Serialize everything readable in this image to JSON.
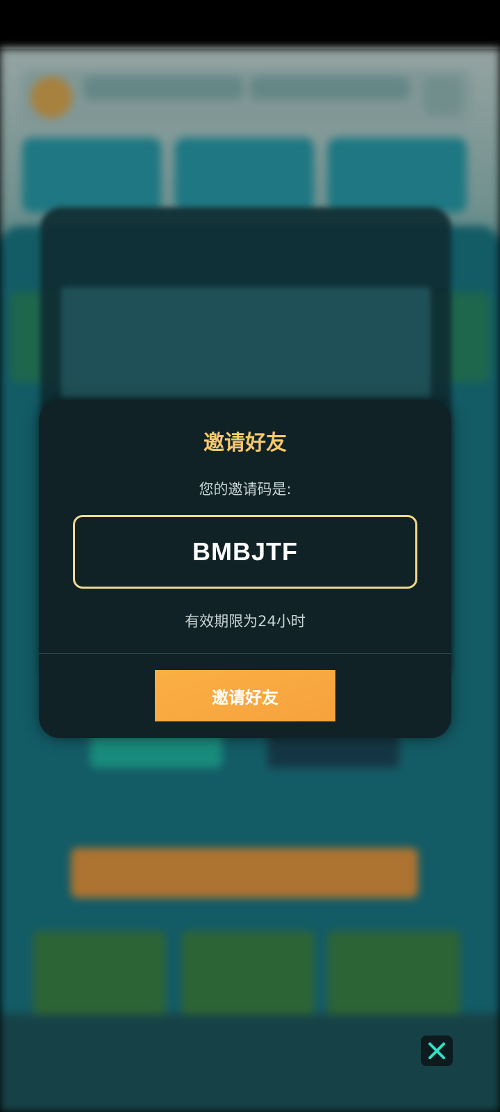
{
  "modal": {
    "title": "邀请好友",
    "subtitle": "您的邀请码是:",
    "invite_code": "BMBJTF",
    "expiry_note": "有效期限为24小时",
    "button_label": "邀请好友"
  },
  "colors": {
    "modal_background": "#102226",
    "title": "#f8c86b",
    "code_border": "#f1d88c",
    "button": "#f6a23e",
    "close_icon": "#2fe0c6"
  },
  "icons": {
    "close": "close-icon"
  }
}
